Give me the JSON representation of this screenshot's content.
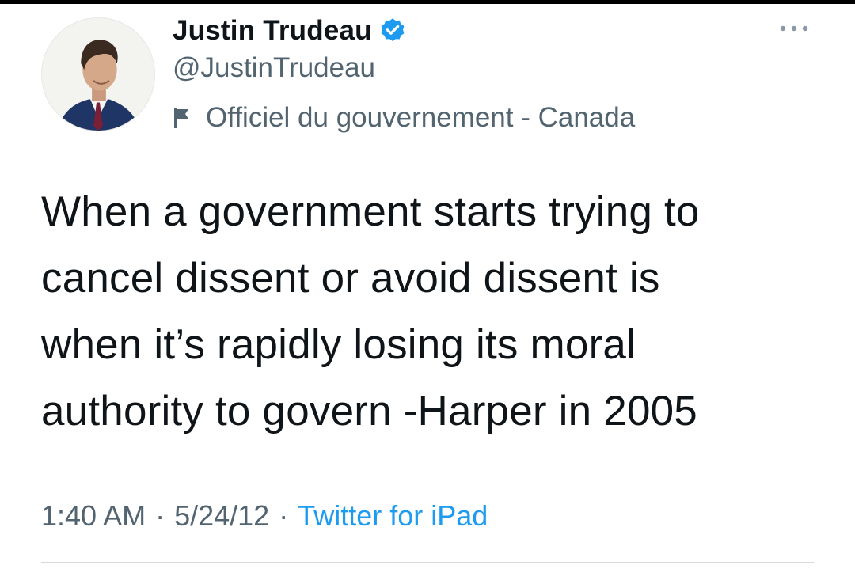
{
  "tweet": {
    "author": {
      "name": "Justin Trudeau",
      "handle": "@JustinTrudeau",
      "verified": true,
      "label": "Officiel du gouvernement - Canada"
    },
    "text": "When a government starts trying to\ncancel dissent or avoid dissent is\nwhen it’s rapidly losing its moral\nauthority to govern -Harper in 2005",
    "time": "1:40 AM",
    "date": "5/24/12",
    "separator": "·",
    "source": "Twitter for iPad"
  },
  "icons": {
    "verified": "verified-badge-icon",
    "label": "flag-icon",
    "more": "more-options-icon"
  },
  "colors": {
    "verified_blue": "#1d9bf0",
    "secondary_text": "#536471",
    "link": "#1d9bf0",
    "text": "#0f1419"
  }
}
